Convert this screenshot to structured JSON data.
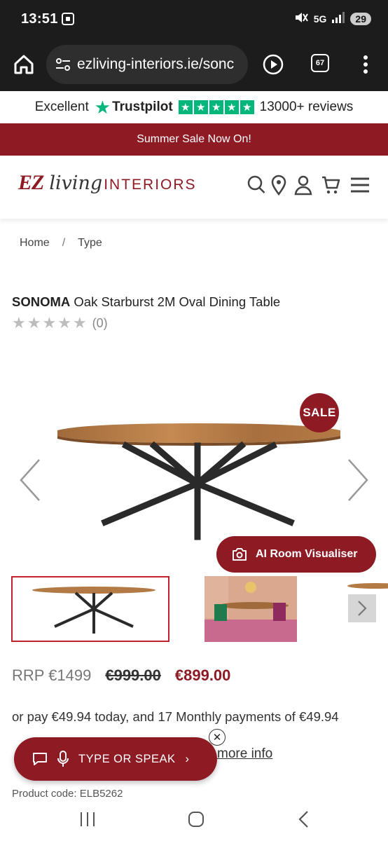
{
  "status_bar": {
    "time": "13:51",
    "battery": "29",
    "network": "5G"
  },
  "browser": {
    "url": "ezliving-interiors.ie/sonc",
    "tab_count": "67"
  },
  "trustpilot": {
    "rating_word": "Excellent",
    "brand": "Trustpilot",
    "reviews": "13000+ reviews",
    "color": "#00b67a"
  },
  "promo_banner": {
    "text": "Summer Sale Now On!"
  },
  "logo": {
    "part1": "EZ",
    "part2": "living",
    "part3": "INTERIORS"
  },
  "header_icons": [
    "search-icon",
    "location-pin-icon",
    "account-icon",
    "cart-icon",
    "hamburger-menu-icon"
  ],
  "breadcrumb": {
    "home": "Home",
    "separator": "/",
    "current": "Type"
  },
  "product": {
    "brand": "SONOMA",
    "name": "Oak Starburst 2M Oval Dining Table",
    "rating_stars": 0,
    "rating_count": "(0)",
    "sale_badge": "SALE",
    "ai_button": "AI Room Visualiser",
    "rrp": "RRP €1499",
    "old_price": "€999.00",
    "new_price": "€899.00",
    "finance_text": "or pay €49.94 today, and 17 Monthly payments of €49.94",
    "more_info": "more info",
    "product_code": "Product code: ELB5262"
  },
  "assistant": {
    "label": "TYPE OR SPEAK",
    "chevron": "›",
    "close": "✕"
  },
  "colors": {
    "brand": "#8e1a24",
    "dark": "#1c1c1c"
  }
}
